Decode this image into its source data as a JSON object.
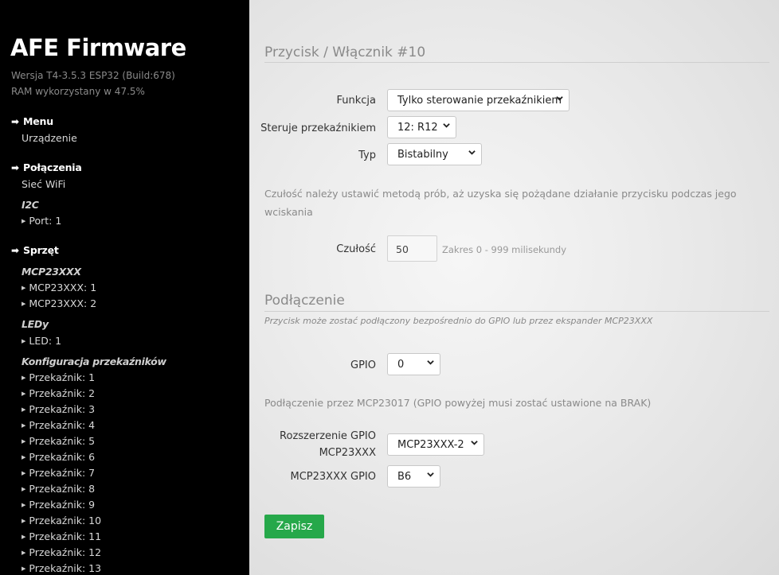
{
  "sidebar": {
    "title": "AFE Firmware",
    "version": "Wersja T4-3.5.3 ESP32 (Build:678)",
    "ram": "RAM wykorzystany w 47.5%",
    "menu": {
      "label": "Menu",
      "items": [
        "Urządzenie"
      ]
    },
    "connections": {
      "label": "Połączenia",
      "wifi": "Sieć WiFi",
      "i2c_label": "I2C",
      "i2c_items": [
        "Port: 1"
      ]
    },
    "hardware": {
      "label": "Sprzęt",
      "mcp_label": "MCP23XXX",
      "mcp_items": [
        "MCP23XXX: 1",
        "MCP23XXX: 2"
      ],
      "led_label": "LEDy",
      "led_items": [
        "LED: 1"
      ],
      "relay_label": "Konfiguracja przekaźników",
      "relay_items": [
        "Przekaźnik: 1",
        "Przekaźnik: 2",
        "Przekaźnik: 3",
        "Przekaźnik: 4",
        "Przekaźnik: 5",
        "Przekaźnik: 6",
        "Przekaźnik: 7",
        "Przekaźnik: 8",
        "Przekaźnik: 9",
        "Przekaźnik: 10",
        "Przekaźnik: 11",
        "Przekaźnik: 12",
        "Przekaźnik: 13"
      ]
    }
  },
  "form": {
    "heading": "Przycisk / Włącznik #10",
    "funkcja": {
      "label": "Funkcja",
      "value": "Tylko sterowanie przekaźnikiem"
    },
    "steruje": {
      "label": "Steruje przekaźnikiem",
      "value": "12: R12"
    },
    "typ": {
      "label": "Typ",
      "value": "Bistabilny"
    },
    "sensitivity_note": "Czułość należy ustawić metodą prób, aż uzyska się pożądane działanie przycisku podczas jego wciskania",
    "czulosc": {
      "label": "Czułość",
      "value": "50",
      "hint": "Zakres 0 - 999 milisekundy"
    }
  },
  "connection": {
    "heading": "Podłączenie",
    "subtitle": "Przycisk może zostać podłączony bezpośrednio do GPIO lub przez ekspander MCP23XXX",
    "gpio": {
      "label": "GPIO",
      "value": "0"
    },
    "mcp_note": "Podłączenie przez MCP23017 (GPIO powyżej musi zostać ustawione na BRAK)",
    "expander": {
      "label_line1": "Rozszerzenie GPIO",
      "label_line2": "MCP23XXX",
      "value": "MCP23XXX-2"
    },
    "mcp_gpio": {
      "label": "MCP23XXX GPIO",
      "value": "B6"
    }
  },
  "save_button": "Zapisz",
  "colors": {
    "sidebar_bg": "#000000",
    "save_button": "#26a84a"
  }
}
